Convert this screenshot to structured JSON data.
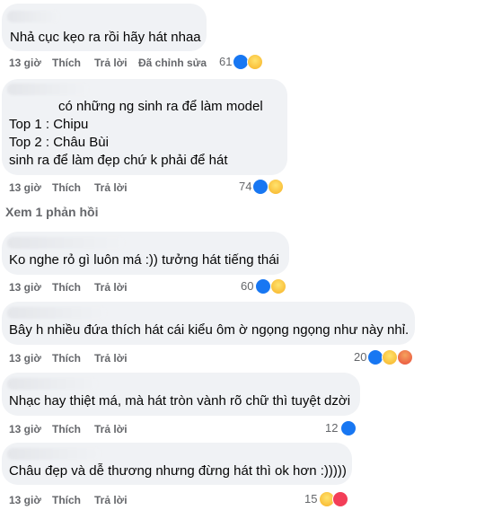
{
  "comments": [
    {
      "lines": [
        "Nhả cục kẹo ra rồi hãy hát nhaa"
      ],
      "time": "13 giờ",
      "like": "Thích",
      "reply": "Trả lời",
      "edited": "Đã chỉnh sửa",
      "reaction_count": "61",
      "reactions": [
        "like",
        "haha"
      ]
    },
    {
      "lines": [
        "có những ng sinh ra để làm model",
        "Top 1 : Chipu",
        "Top 2 : Châu Bùi",
        "sinh ra để làm đẹp chứ k phải để hát"
      ],
      "time": "13 giờ",
      "like": "Thích",
      "reply": "Trả lời",
      "reaction_count": "74",
      "reactions": [
        "like",
        "haha"
      ]
    },
    {
      "lines": [
        "Ko nghe rỏ gì luôn má :)) tưởng hát tiếng thái"
      ],
      "time": "13 giờ",
      "like": "Thích",
      "reply": "Trả lời",
      "reaction_count": "60",
      "reactions": [
        "like",
        "haha"
      ]
    },
    {
      "lines": [
        "Bây h nhiều đứa thích hát cái kiểu ôm ờ ngọng ngọng như này nhỉ."
      ],
      "time": "13 giờ",
      "like": "Thích",
      "reply": "Trả lời",
      "reaction_count": "20",
      "reactions": [
        "like",
        "haha",
        "angry"
      ]
    },
    {
      "lines": [
        "Nhạc hay thiệt má, mà hát tròn vành rõ chữ thì tuyệt dzời"
      ],
      "time": "13 giờ",
      "like": "Thích",
      "reply": "Trả lời",
      "reaction_count": "12",
      "reactions": [
        "like"
      ]
    },
    {
      "lines": [
        "Châu đẹp và dễ thương nhưng đừng hát thì ok hơn :)))))"
      ],
      "time": "13 giờ",
      "like": "Thích",
      "reply": "Trả lời",
      "reaction_count": "15",
      "reactions": [
        "haha",
        "love"
      ]
    }
  ],
  "view_replies": "Xem 1 phản hồi",
  "colors": {
    "bubble": "#f0f2f5",
    "meta": "#65676b",
    "like": "#1877f2",
    "haha": "#f7b125",
    "angry": "#e94b3c",
    "love": "#f33e58"
  }
}
